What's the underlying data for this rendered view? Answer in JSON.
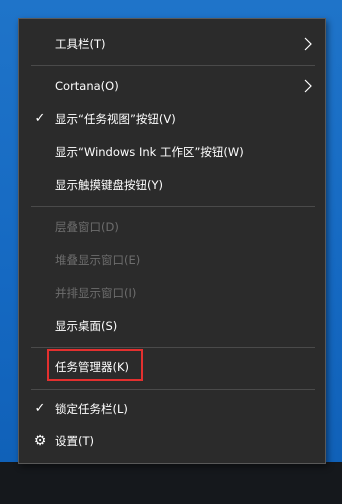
{
  "menu": {
    "items": [
      {
        "label": "工具栏(T)"
      },
      {
        "label": "Cortana(O)"
      },
      {
        "label": "显示“任务视图”按钮(V)"
      },
      {
        "label": "显示“Windows Ink 工作区”按钮(W)"
      },
      {
        "label": "显示触摸键盘按钮(Y)"
      },
      {
        "label": "层叠窗口(D)"
      },
      {
        "label": "堆叠显示窗口(E)"
      },
      {
        "label": "并排显示窗口(I)"
      },
      {
        "label": "显示桌面(S)"
      },
      {
        "label": "任务管理器(K)"
      },
      {
        "label": "锁定任务栏(L)"
      },
      {
        "label": "设置(T)"
      }
    ]
  },
  "colors": {
    "menu_background": "#2b2b2b",
    "desktop_blue": "#1769c4",
    "highlight_red": "#e3302f",
    "disabled_text": "#6d6d6d"
  },
  "icons": {
    "checkmark": "checkmark-icon",
    "submenu_arrow": "chevron-right-icon",
    "settings": "gear-icon"
  }
}
